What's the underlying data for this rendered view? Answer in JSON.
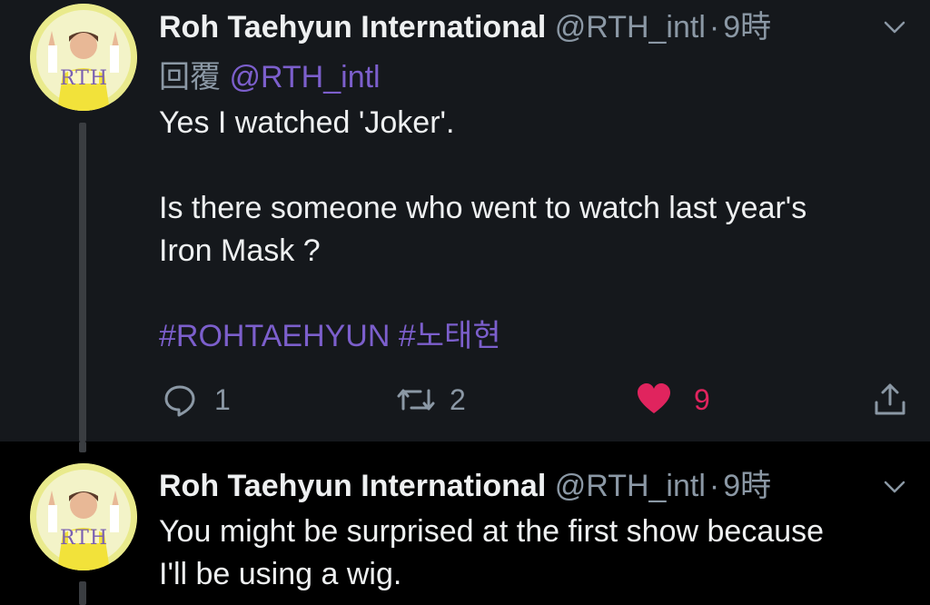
{
  "tweets": [
    {
      "author_name": "Roh Taehyun International",
      "handle": "@RTH_intl",
      "time": "9時",
      "reply_label": "回覆",
      "reply_to": "@RTH_intl",
      "text_line1": "Yes I watched 'Joker'.",
      "text_line2": "Is there someone who went to watch last year's",
      "text_line3": "Iron Mask ?",
      "hashtags": "#ROHTAEHYUN #노태현",
      "reply_count": "1",
      "retweet_count": "2",
      "like_count": "9",
      "avatar_text": "RTH"
    },
    {
      "author_name": "Roh Taehyun International",
      "handle": "@RTH_intl",
      "time": "9時",
      "text_line1": "You might be surprised at the first show because",
      "text_line2": "I'll be using a wig.",
      "avatar_text": "RTH"
    }
  ],
  "icons": {
    "reply": "reply-icon",
    "retweet": "retweet-icon",
    "like": "heart-icon",
    "share": "share-icon",
    "more": "chevron-down-icon"
  },
  "colors": {
    "background_top": "#15181c",
    "background_bottom": "#000000",
    "link": "#7c5fcc",
    "like": "#e0245e",
    "secondary": "#8b98a5"
  }
}
